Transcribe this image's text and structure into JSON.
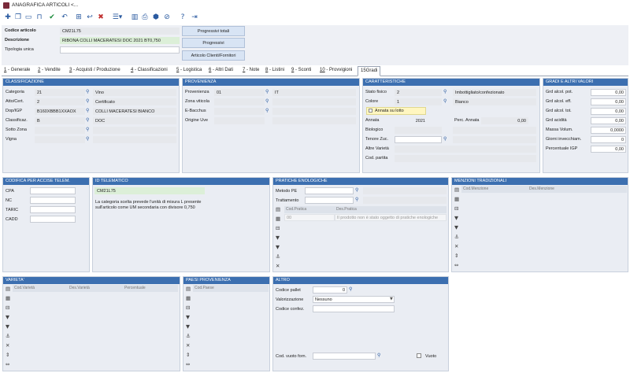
{
  "window": {
    "title": "ANAGRAFICA ARTICOLI <..."
  },
  "header": {
    "codice_label": "Codice articolo",
    "codice_value": "CM21L75",
    "descrizione_label": "Descrizione",
    "descrizione_value": "RIBONA COLLI MACERATESI DOC 2021 BT0,750",
    "tipologia_label": "Tipologia unica",
    "btn_totali": "Progressivi totali",
    "btn_progressivi": "Progressivi",
    "btn_clienti": "Articolo Clienti/Fornitori"
  },
  "tabs": [
    {
      "num": "1",
      "label": " - Generale"
    },
    {
      "num": "2",
      "label": " - Vendite"
    },
    {
      "num": "3",
      "label": " - Acquisti / Produzione"
    },
    {
      "num": "4",
      "label": " - Classificazioni"
    },
    {
      "num": "5",
      "label": " - Logistica"
    },
    {
      "num": "6",
      "label": " - Altri Dati"
    },
    {
      "num": "7",
      "label": " - Note"
    },
    {
      "num": "8",
      "label": " - Listini"
    },
    {
      "num": "9",
      "label": " - Sconti"
    },
    {
      "num": "10",
      "label": " - Provvigioni"
    },
    {
      "num": "15",
      "label": "Gradi"
    }
  ],
  "classificazione": {
    "title": "CLASSIFICAZIONE",
    "rows": [
      {
        "label": "Categoria",
        "code": "21",
        "desc": "Vino"
      },
      {
        "label": "Atto/Cert.",
        "code": "2",
        "desc": "Certificato"
      },
      {
        "label": "Dop/IGP",
        "code": "B160XBBB1XXAOX",
        "desc": "COLLI MACERATESI BIANCO"
      },
      {
        "label": "Classificaz.",
        "code": "B",
        "desc": "DOC"
      },
      {
        "label": "Sotto Zona",
        "code": "",
        "desc": ""
      },
      {
        "label": "Vigna",
        "code": "",
        "desc": ""
      }
    ]
  },
  "provenienza": {
    "title": "PROVENIENZA",
    "rows": [
      {
        "label": "Provenienza",
        "code": "01",
        "desc": "IT"
      },
      {
        "label": "Zona viticola",
        "code": "",
        "desc": ""
      },
      {
        "label": "E-Bacchus",
        "code": "",
        "desc": ""
      },
      {
        "label": "Origine Uve",
        "code": "",
        "desc": ""
      }
    ]
  },
  "caratteristiche": {
    "title": "CARATTERISTICHE",
    "stato_label": "Stato fisico",
    "stato_code": "2",
    "stato_desc": "Imbottigliato/confezionato",
    "colore_label": "Colore",
    "colore_code": "1",
    "colore_desc": "Bianco",
    "annata_lotto_label": "Annata su lotto",
    "annata_label": "Annata",
    "annata_value": "2021",
    "perc_annata_label": "Perc. Annata",
    "perc_annata_value": "0,00",
    "biologico_label": "Biologico",
    "tenore_label": "Tenore Zuc.",
    "altre_label": "Altre Varietà",
    "partita_label": "Cod. partita"
  },
  "gradi": {
    "title": "GRADI E ALTRI VALORI",
    "rows": [
      {
        "label": "Grd alcol. pot.",
        "value": "0,00"
      },
      {
        "label": "Grd alcol. eff.",
        "value": "0,00"
      },
      {
        "label": "Grd alcol. tot.",
        "value": "0,00"
      },
      {
        "label": "Grd acidità",
        "value": "0,00"
      },
      {
        "label": "Massa Volum.",
        "value": "0,0000"
      },
      {
        "label": "Giorni invecchiam.",
        "value": "0"
      },
      {
        "label": "Percentuale IGP",
        "value": "0,00"
      }
    ]
  },
  "accise": {
    "title": "CODIFICA PER ACCISE TELEM.",
    "rows": [
      {
        "label": "CPA"
      },
      {
        "label": "NC"
      },
      {
        "label": "TARIC"
      },
      {
        "label": "CADD"
      }
    ]
  },
  "telematico": {
    "title": "ID TELEMATICO",
    "code": "CM21L75",
    "note": "La categoria scelta prevede l'unità di misura L presente sull'articolo come UM secondaria con divisore 0,750"
  },
  "pratiche": {
    "title": "PRATICHE ENOLOGICHE",
    "metodo_label": "Metodo PE",
    "trattamento_label": "Trattamento",
    "col1": "Cod.Pratica",
    "col2": "Des.Pratica",
    "row_code": "00",
    "row_desc": "Il prodotto non è stato oggetto di pratiche enologiche"
  },
  "menzioni": {
    "title": "MENZIONI TRADIZIONALI",
    "col1": "Cod.Menzione",
    "col2": "Des.Menzione"
  },
  "varieta": {
    "title": "VARIETA'",
    "col1": "Cod.Varietà",
    "col2": "Des.Varietà",
    "col3": "Percentuale"
  },
  "paesi": {
    "title": "PAESI PROVENIENZA",
    "col1": "Cod.Paese"
  },
  "altro": {
    "title": "ALTRO",
    "pallet_label": "Codice pallet",
    "pallet_value": "0",
    "valorizzazione_label": "Valorizzazione",
    "valorizzazione_value": "Nessuno",
    "confez_label": "Codice confez.",
    "vuoto_label": "Cod. vuoto forn.",
    "vuoto_check_label": "Vuoto"
  }
}
